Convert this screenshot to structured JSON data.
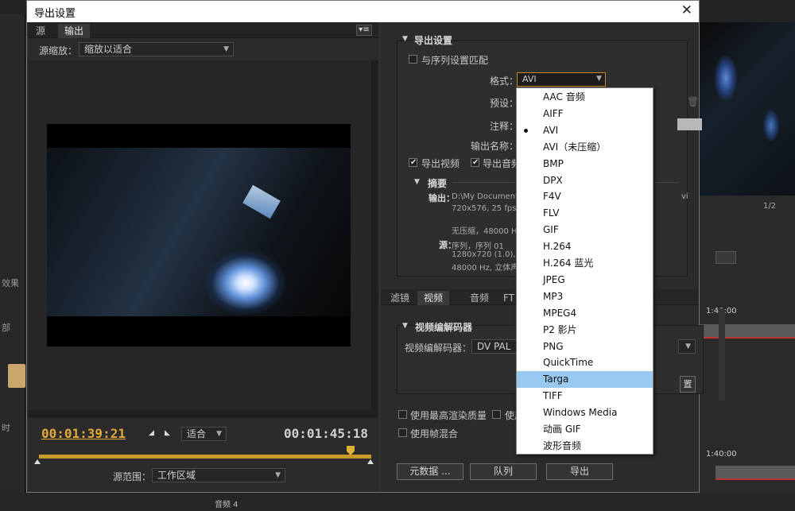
{
  "dialog": {
    "title": "导出设置",
    "close": "✕"
  },
  "left": {
    "tabs": [
      "源",
      "输出"
    ],
    "source_scale_label": "源缩放：",
    "source_scale_value": "缩放以适合",
    "current_time": "00:01:39:21",
    "fit_value": "适合",
    "duration": "00:01:45:18",
    "source_range_label": "源范围：",
    "source_range_value": "工作区域"
  },
  "export": {
    "section": "导出设置",
    "match_seq": "与序列设置匹配",
    "format_label": "格式：",
    "format_value": "AVI",
    "preset_label": "预设：",
    "comment_label": "注释：",
    "output_name_label": "输出名称：",
    "export_video": "导出视频",
    "export_audio": "导出音频",
    "summary_title": "摘要",
    "output_label": "输出：",
    "output_line1": "D:\\My Documents",
    "output_line1_suffix": "vi",
    "output_line2": "720x576, 25 fps,",
    "output_line3": "无压缩，48000 H",
    "source_label": "源：",
    "source_line1": "序列，序列 01",
    "source_line2": "1280x720 (1.0), 2",
    "source_line3": "48000 Hz, 立体声"
  },
  "settings_tabs": [
    "滤镜",
    "视频",
    "音频",
    "FT"
  ],
  "codec": {
    "section": "视频编解码器",
    "label": "视频编解码器：",
    "value": "DV PAL",
    "settings_btn_partial": "置"
  },
  "options": {
    "max_render": "使用最高渲染质量",
    "use_partial": "使用",
    "frame_blend": "使用帧混合"
  },
  "buttons": {
    "metadata": "元数据 ...",
    "queue": "队列",
    "export": "导出"
  },
  "format_options": [
    "AAC 音频",
    "AIFF",
    "AVI",
    "AVI（未压缩）",
    "BMP",
    "DPX",
    "F4V",
    "FLV",
    "GIF",
    "H.264",
    "H.264 蓝光",
    "JPEG",
    "MP3",
    "MPEG4",
    "P2 影片",
    "PNG",
    "QuickTime",
    "Targa",
    "TIFF",
    "Windows Media",
    "动画 GIF",
    "波形音频"
  ],
  "format_selected": "AVI",
  "format_hovered": "Targa",
  "background": {
    "right_time1": "1:40:00",
    "right_time2": "1:40:00",
    "pager": "1/2",
    "effects_tab": "效果",
    "bottom_track": "音频 4",
    "partial_left": "部",
    "partial_left2": "时"
  },
  "colors": {
    "accent": "#c99a2a",
    "highlight": "#99c9ef"
  }
}
